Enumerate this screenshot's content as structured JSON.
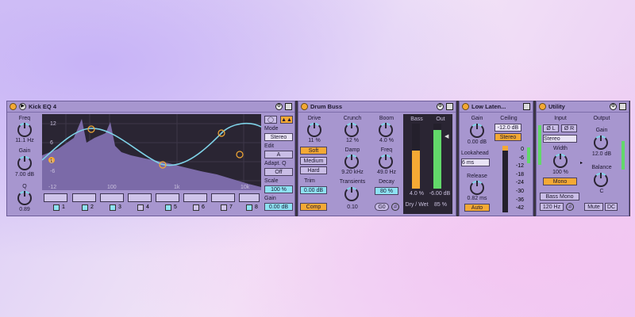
{
  "eq": {
    "title": "Kick EQ 4",
    "freq_label": "Freq",
    "freq_value": "11.1 Hz",
    "gain_label": "Gain",
    "gain_value": "7.00 dB",
    "q_label": "Q",
    "q_value": "0.89",
    "y_ticks": [
      "12",
      "6",
      "0",
      "-6",
      "-12"
    ],
    "x_ticks": [
      "100",
      "1k",
      "10k"
    ],
    "bands": [
      "1",
      "2",
      "3",
      "4",
      "5",
      "6",
      "7",
      "8"
    ],
    "mode_label": "Mode",
    "mode_value": "Stereo",
    "edit_label": "Edit",
    "edit_value": "A",
    "adaptq_label": "Adapt. Q",
    "adaptq_value": "Off",
    "scale_label": "Scale",
    "scale_value": "100 %",
    "outgain_label": "Gain",
    "outgain_value": "0.00 dB",
    "marker_label": "1"
  },
  "buss": {
    "title": "Drum Buss",
    "drive_label": "Drive",
    "drive_value": "11 %",
    "crunch_label": "Crunch",
    "crunch_value": "12 %",
    "boom_label": "Boom",
    "boom_value": "4.0 %",
    "soft": "Soft",
    "medium": "Medium",
    "hard": "Hard",
    "damp_label": "Damp",
    "damp_value": "9.20 kHz",
    "freq_label": "Freq",
    "freq_value": "49.0 Hz",
    "trim_label": "Trim",
    "trim_value": "0.00 dB",
    "transients_label": "Transients",
    "transients_value": "0.10",
    "decay_label": "Decay",
    "decay_value": "80 %",
    "comp": "Comp",
    "g0": "G0",
    "bass_label": "Bass",
    "out_label": "Out",
    "bass_value": "4.0 %",
    "out_value": "-6.00 dB",
    "drywet_label": "Dry / Wet",
    "drywet_value": "85 %",
    "bass_level": 0.58,
    "out_level": 0.9
  },
  "limiter": {
    "title": "Low Laten...",
    "gain_label": "Gain",
    "gain_value": "0.00 dB",
    "ceiling_label": "Ceiling",
    "ceiling_value": "-12.0 dB",
    "stereo": "Stereo",
    "lookahead_label": "Lookahead",
    "lookahead_value": "6 ms",
    "release_label": "Release",
    "release_value": "0.82 ms",
    "auto": "Auto",
    "scale": [
      "0",
      "-6",
      "-12",
      "-18",
      "-24",
      "-30",
      "-36",
      "-42"
    ]
  },
  "utility": {
    "title": "Utility",
    "input_label": "Input",
    "output_label": "Output",
    "phase_l": "Ø L",
    "phase_r": "Ø R",
    "channel_value": "Stereo",
    "width_label": "Width",
    "width_value": "100 %",
    "mono": "Mono",
    "bassmono": "Bass Mono",
    "bassmono_freq": "120 Hz",
    "gain_label": "Gain",
    "gain_value": "12.0 dB",
    "balance_label": "Balance",
    "balance_value": "C",
    "mute": "Mute",
    "dc": "DC"
  },
  "colors": {
    "accent": "#f4a934",
    "blue": "#8ee2f3",
    "curve": "#7fd3e8",
    "panel": "#a796cf"
  }
}
